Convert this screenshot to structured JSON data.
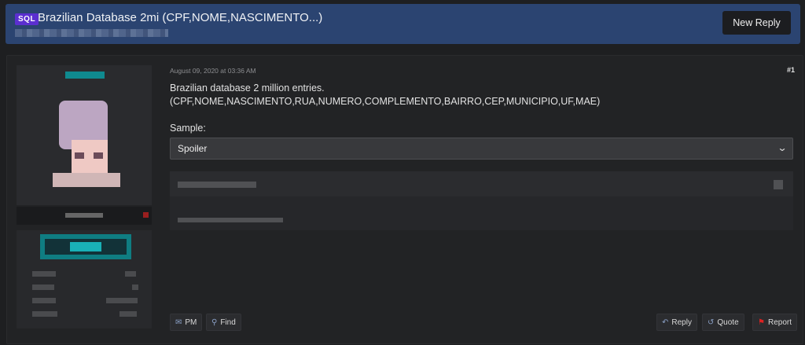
{
  "thread": {
    "prefix": "SQL",
    "title": "Brazilian Database 2mi (CPF,NOME,NASCIMENTO...)",
    "new_reply_label": "New Reply"
  },
  "post": {
    "date": "August 09, 2020 at 03:36 AM",
    "number": "#1",
    "message_line1": "Brazilian database 2 million entries.",
    "message_line2": "(CPF,NOME,NASCIMENTO,RUA,NUMERO,COMPLEMENTO,BAIRRO,CEP,MUNICIPIO,UF,MAE)",
    "sample_label": "Sample:",
    "spoiler_label": "Spoiler"
  },
  "actions": {
    "pm": "PM",
    "find": "Find",
    "reply": "Reply",
    "quote": "Quote",
    "report": "Report"
  },
  "icons": {
    "pm": "pm-icon",
    "find": "search-icon",
    "reply": "reply-icon",
    "quote": "quote-icon",
    "report": "flag-icon",
    "spoiler": "chevron-down-icon"
  },
  "colors": {
    "header_bg": "#2b4471",
    "prefix_bg": "#5b2fd0",
    "report_flag": "#dd2222"
  }
}
